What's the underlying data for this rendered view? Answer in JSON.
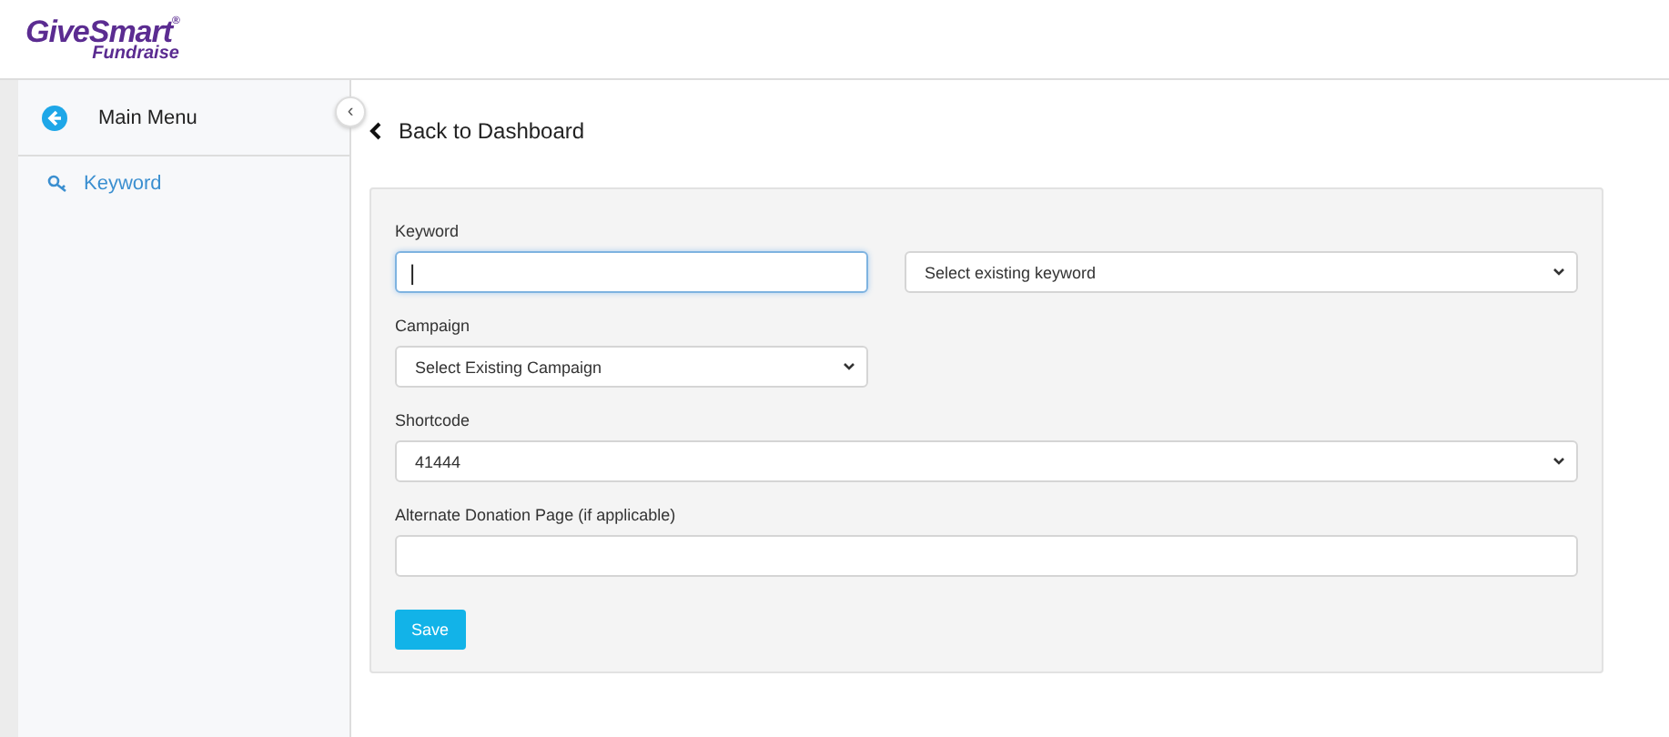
{
  "logo": {
    "brand": "GiveSmart",
    "trademark": "®",
    "product": "Fundraise"
  },
  "sidebar": {
    "main_menu": "Main Menu",
    "collapse_button": "‹",
    "items": [
      {
        "label": "Keyword",
        "selected": true
      }
    ]
  },
  "back_link": "Back to Dashboard",
  "form": {
    "rows": [
      {
        "fields": [
          {
            "kind": "input",
            "label": "Keyword",
            "value": "|",
            "focused": true
          },
          {
            "kind": "select",
            "value": "Select existing keyword"
          }
        ]
      },
      {
        "fields": [
          {
            "kind": "select",
            "label": "Campaign",
            "value": "Select Existing Campaign"
          }
        ]
      },
      {
        "fields": [
          {
            "kind": "select",
            "label": "Shortcode",
            "value": "41444"
          }
        ]
      },
      {
        "fields": [
          {
            "kind": "input",
            "label": "Alternate Donation Page (if applicable)",
            "focused": false
          }
        ]
      }
    ],
    "save_button": "Save"
  }
}
